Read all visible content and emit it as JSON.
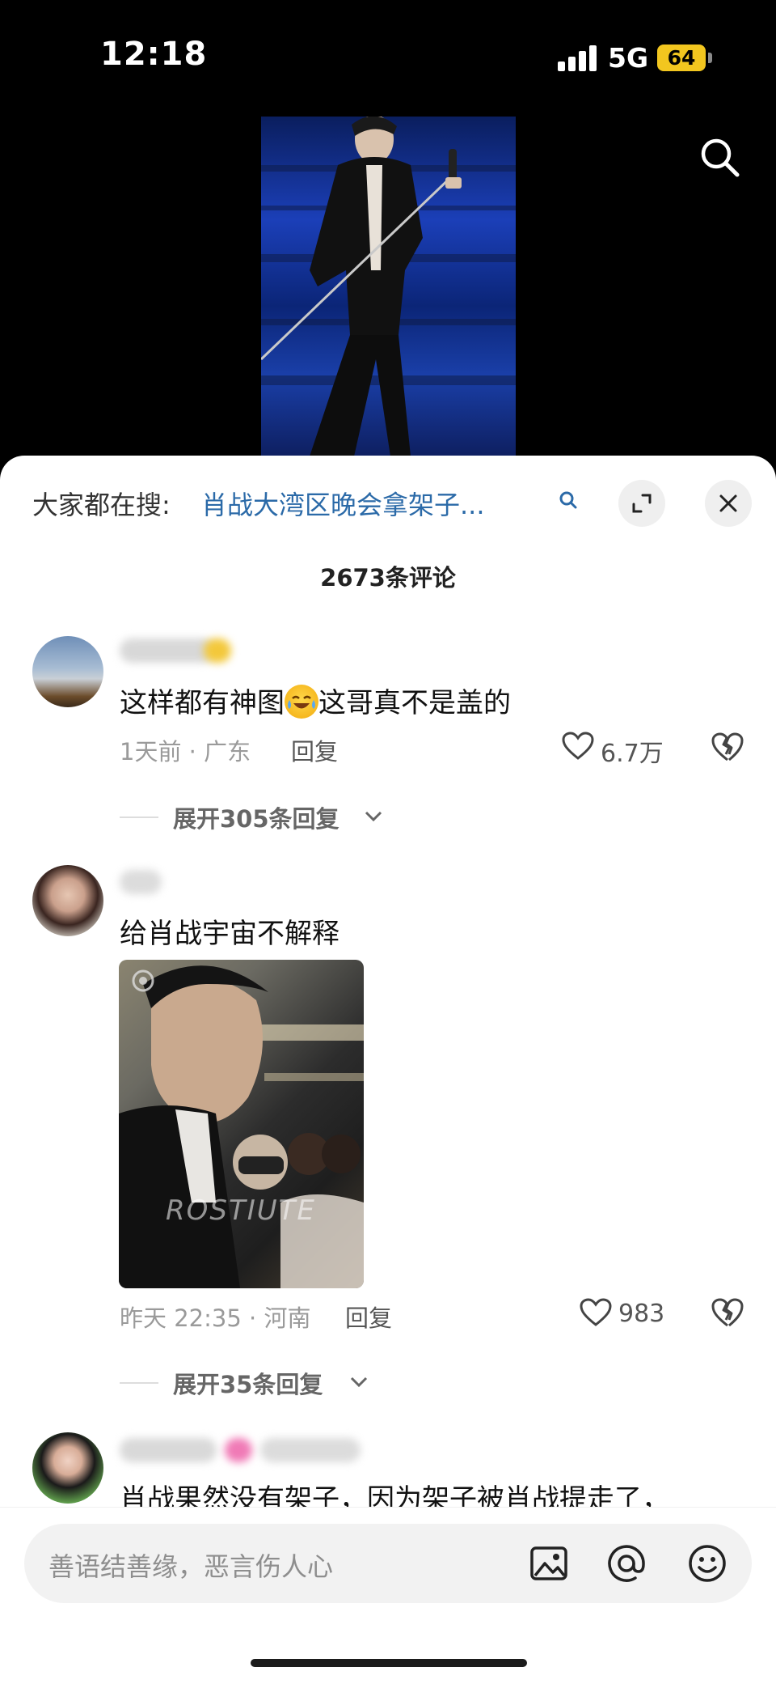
{
  "status_bar": {
    "time": "12:18",
    "network": "5G",
    "battery": "64"
  },
  "header": {
    "hint_prefix": "大家都在搜:",
    "hint_query": "肖战大湾区晚会拿架子...",
    "comment_count": "2673条评论"
  },
  "comments": [
    {
      "text": "这样都有神图",
      "text_after_emoji": "这哥真不是盖的",
      "time": "1天前 · 广东",
      "reply_label": "回复",
      "likes": "6.7万",
      "expand_label": "展开305条回复"
    },
    {
      "text": "给肖战宇宙不解释",
      "image_watermark": "ROSTIUTE",
      "time": "昨天 22:35 · 河南",
      "reply_label": "回复",
      "likes": "983",
      "expand_label": "展开35条回复"
    },
    {
      "text": "肖战果然没有架子，因为架子被肖战提走了，"
    }
  ],
  "input_bar": {
    "placeholder": "善语结善缘，恶言伤人心"
  },
  "icons": {
    "search": "search-icon",
    "expand": "expand-icon",
    "close": "close-icon",
    "like": "heart-icon",
    "dislike": "broken-heart-icon",
    "image": "image-icon",
    "mention": "at-icon",
    "emoji": "emoji-icon"
  },
  "colors": {
    "link": "#2b6aa8",
    "battery": "#f2c61f"
  }
}
